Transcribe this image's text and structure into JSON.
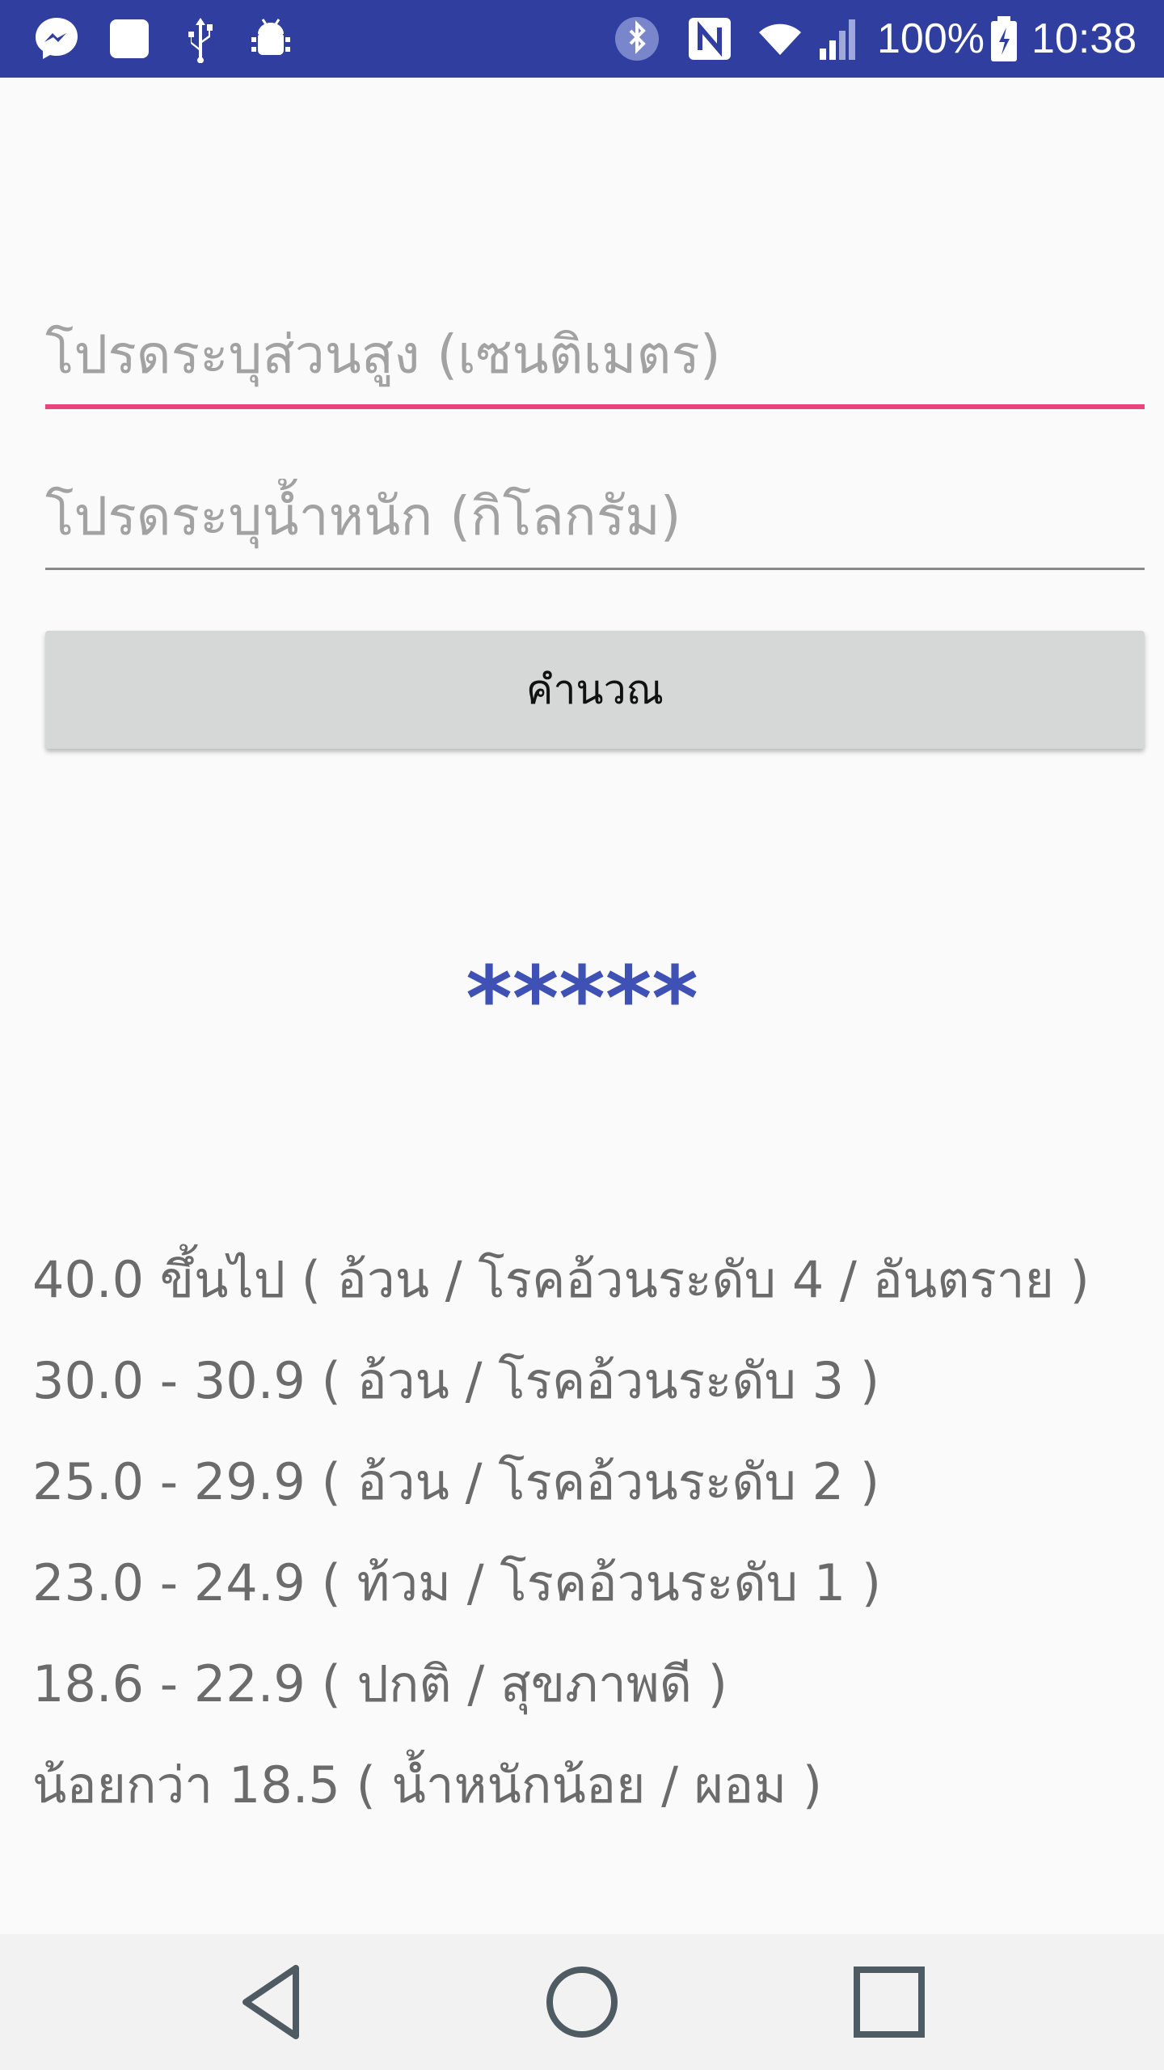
{
  "status_bar": {
    "battery": "100%",
    "time": "10:38",
    "icons": [
      "messenger-icon",
      "notification-square-icon",
      "usb-icon",
      "android-debug-icon",
      "bluetooth-icon",
      "nfc-icon",
      "wifi-icon",
      "signal-icon",
      "battery-charging-icon"
    ]
  },
  "form": {
    "height_placeholder": "โปรดระบุส่วนสูง (เซนติเมตร)",
    "weight_placeholder": "โปรดระบุน้ำหนัก (กิโลกรัม)",
    "calculate_label": "คำนวณ"
  },
  "result": {
    "value": "*****"
  },
  "legend": [
    "40.0 ขึ้นไป ( อ้วน / โรคอ้วนระดับ 4 / อันตราย )",
    "30.0 - 30.9 ( อ้วน / โรคอ้วนระดับ 3 )",
    "25.0 - 29.9 ( อ้วน / โรคอ้วนระดับ 2 )",
    "23.0 - 24.9 ( ท้วม / โรคอ้วนระดับ 1 )",
    "18.6 - 22.9 ( ปกติ / สุขภาพดี )",
    "น้อยกว่า 18.5 ( น้ำหนักน้อย / ผอม )"
  ],
  "nav": {
    "icons": [
      "back-icon",
      "home-icon",
      "recents-icon"
    ]
  },
  "colors": {
    "status_bar": "#303f9f",
    "accent": "#e8437a",
    "result": "#3f51b5",
    "button": "#d6d7d7"
  }
}
